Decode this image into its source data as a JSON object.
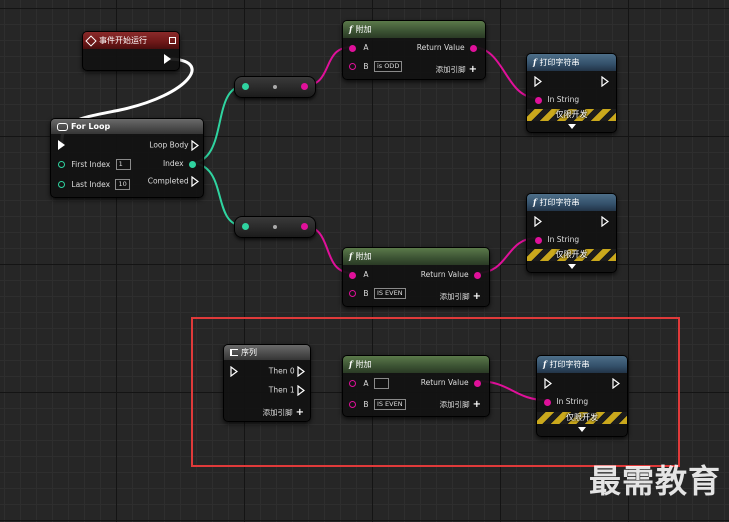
{
  "event_node": {
    "title": "事件开始运行"
  },
  "forloop": {
    "title": "For Loop",
    "first_index_label": "First Index",
    "first_index_value": "1",
    "last_index_label": "Last Index",
    "last_index_value": "10",
    "loop_body_label": "Loop Body",
    "index_label": "Index",
    "completed_label": "Completed"
  },
  "append_top": {
    "title": "附加",
    "a_label": "A",
    "b_label": "B",
    "b_value": "is ODD",
    "return_label": "Return Value",
    "add_pin_label": "添加引脚"
  },
  "append_mid": {
    "title": "附加",
    "a_label": "A",
    "b_label": "B",
    "b_value": "IS EVEN",
    "return_label": "Return Value",
    "add_pin_label": "添加引脚"
  },
  "append_bottom": {
    "title": "附加",
    "a_label": "A",
    "a_value": "",
    "b_label": "B",
    "b_value": "IS EVEN",
    "return_label": "Return Value",
    "add_pin_label": "添加引脚"
  },
  "print_top": {
    "title": "打印字符串",
    "in_label": "In String",
    "dev_label": "仅限开发"
  },
  "print_mid": {
    "title": "打印字符串",
    "in_label": "In String",
    "dev_label": "仅限开发"
  },
  "print_bottom": {
    "title": "打印字符串",
    "in_label": "In String",
    "dev_label": "仅限开发"
  },
  "sequence": {
    "title": "序列",
    "then0_label": "Then 0",
    "then1_label": "Then 1",
    "add_pin_label": "添加引脚"
  },
  "watermark": "最需教育",
  "colors": {
    "exec": "#ffffff",
    "string_pin": "#e0109a",
    "int_pin": "#2fd4a0",
    "highlight_frame": "#e03a3a"
  }
}
